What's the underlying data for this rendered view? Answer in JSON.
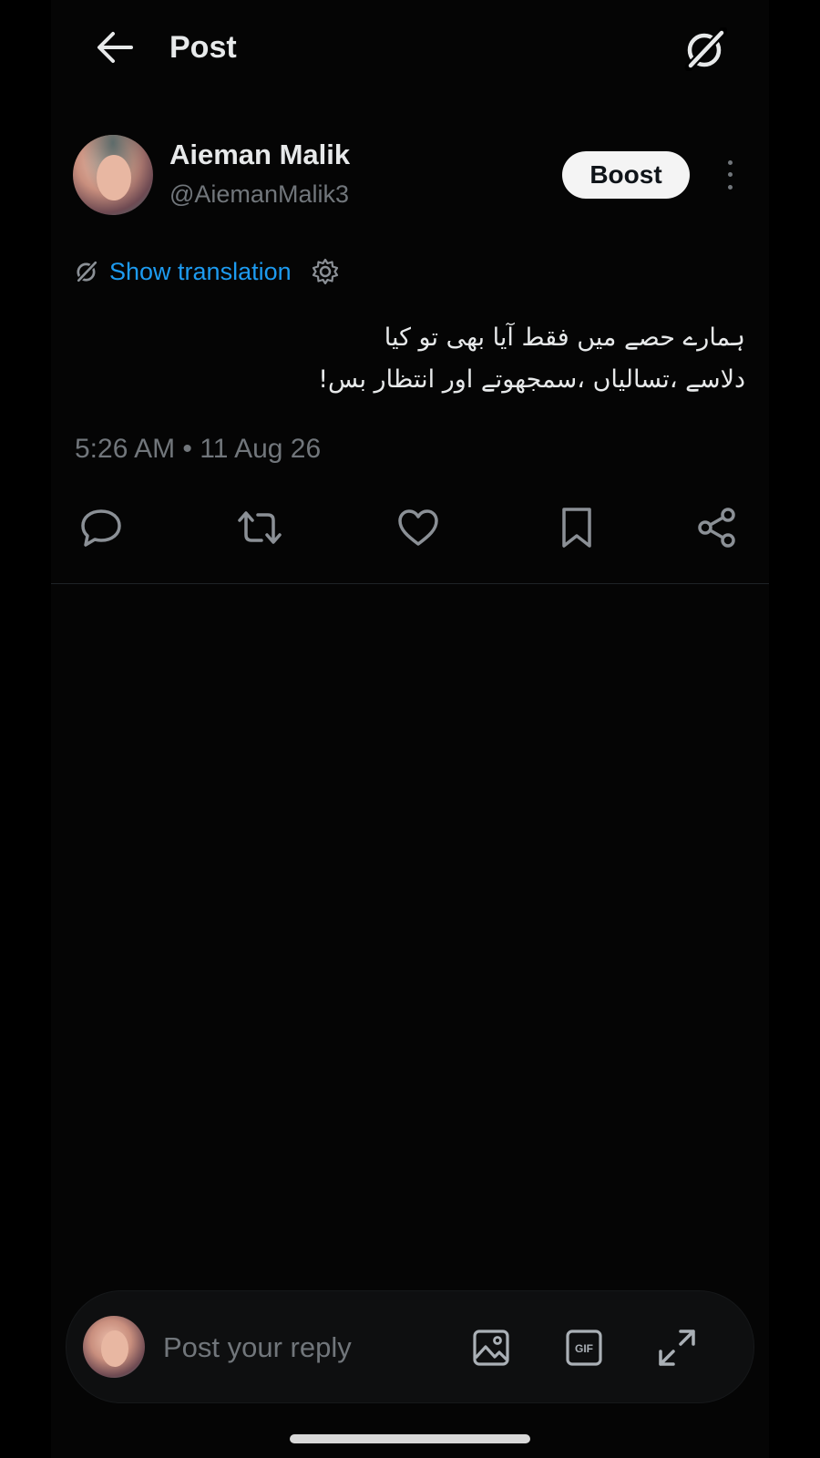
{
  "header": {
    "title": "Post",
    "back_icon": "arrow-left-icon",
    "grok_icon": "grok-icon"
  },
  "post": {
    "author_name": "Aieman Malik",
    "author_handle": "@AiemanMalik3",
    "boost_label": "Boost",
    "translate_label": "Show translation",
    "text_lines": [
      "ہمارے حصے میں فقط آیا بھی تو کیا",
      "دلاسے ،تسالیاں ،سمجھوتے اور انتظار بس!"
    ],
    "timestamp": "5:26 AM • 11 Aug 26"
  },
  "actions": [
    {
      "name": "reply",
      "icon": "comment-icon"
    },
    {
      "name": "repost",
      "icon": "repost-icon"
    },
    {
      "name": "like",
      "icon": "heart-icon"
    },
    {
      "name": "bookmark",
      "icon": "bookmark-icon"
    },
    {
      "name": "share",
      "icon": "share-icon"
    }
  ],
  "reply_bar": {
    "placeholder": "Post your reply",
    "gif_label": "GIF"
  },
  "colors": {
    "background": "#000000",
    "text": "#e7e9ea",
    "muted": "#71767b",
    "link": "#1d9bf0"
  }
}
